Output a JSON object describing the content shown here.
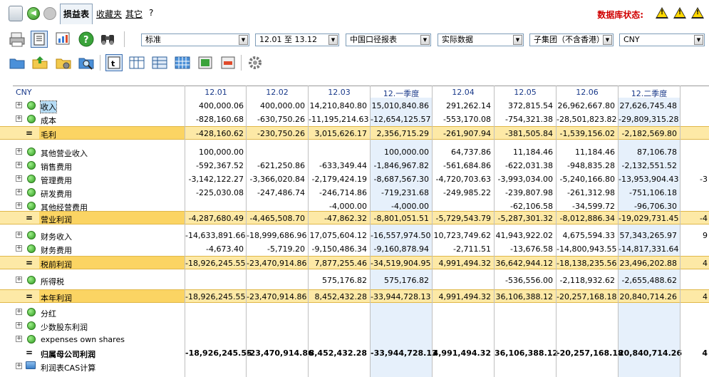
{
  "menu": {
    "tab_pl": "损益表",
    "favorites": "收藏夹",
    "other": "其它",
    "help": "?",
    "db_status": "数据库状态:",
    "warn_icons": [
      "!",
      "!",
      "!"
    ]
  },
  "filters": {
    "standard": "标准",
    "period": "12.01 至 13.12",
    "report": "中国口径报表",
    "data_type": "实际数据",
    "entity": "子集团（不含香港）",
    "currency": "CNY"
  },
  "grid": {
    "currency": "CNY",
    "columns": [
      "12.01",
      "12.02",
      "12.03",
      "12.一季度",
      "12.04",
      "12.05",
      "12.06",
      "12.二季度",
      ""
    ],
    "rows": [
      {
        "kind": "item",
        "label": "收入",
        "highlight": true,
        "values": [
          "400,000.06",
          "400,000.00",
          "14,210,840.80",
          "15,010,840.86",
          "291,262.14",
          "372,815.54",
          "26,962,667.80",
          "27,626,745.48",
          ""
        ]
      },
      {
        "kind": "item",
        "label": "成本",
        "values": [
          "-828,160.68",
          "-630,750.26",
          "-11,195,214.63",
          "-12,654,125.57",
          "-553,170.08",
          "-754,321.38",
          "-28,501,823.82",
          "-29,809,315.28",
          ""
        ]
      },
      {
        "kind": "sub",
        "label": "毛利",
        "values": [
          "-428,160.62",
          "-230,750.26",
          "3,015,626.17",
          "2,356,715.29",
          "-261,907.94",
          "-381,505.84",
          "-1,539,156.02",
          "-2,182,569.80",
          ""
        ]
      },
      {
        "kind": "item",
        "label": "其他营业收入",
        "values": [
          "100,000.00",
          "",
          "",
          "100,000.00",
          "64,737.86",
          "11,184.46",
          "11,184.46",
          "87,106.78",
          ""
        ]
      },
      {
        "kind": "item",
        "label": "销售费用",
        "values": [
          "-592,367.52",
          "-621,250.86",
          "-633,349.44",
          "-1,846,967.82",
          "-561,684.86",
          "-622,031.38",
          "-948,835.28",
          "-2,132,551.52",
          ""
        ]
      },
      {
        "kind": "item",
        "label": "管理费用",
        "values": [
          "-3,142,122.27",
          "-3,366,020.84",
          "-2,179,424.19",
          "-8,687,567.30",
          "-4,720,703.63",
          "-3,993,034.00",
          "-5,240,166.80",
          "-13,953,904.43",
          "-3"
        ]
      },
      {
        "kind": "item",
        "label": "研发费用",
        "values": [
          "-225,030.08",
          "-247,486.74",
          "-246,714.86",
          "-719,231.68",
          "-249,985.22",
          "-239,807.98",
          "-261,312.98",
          "-751,106.18",
          ""
        ]
      },
      {
        "kind": "item",
        "label": "其他经营费用",
        "values": [
          "",
          "",
          "-4,000.00",
          "-4,000.00",
          "",
          "-62,106.58",
          "-34,599.72",
          "-96,706.30",
          ""
        ]
      },
      {
        "kind": "sub",
        "label": "营业利润",
        "values": [
          "-4,287,680.49",
          "-4,465,508.70",
          "-47,862.32",
          "-8,801,051.51",
          "-5,729,543.79",
          "-5,287,301.32",
          "-8,012,886.34",
          "-19,029,731.45",
          "-4"
        ]
      },
      {
        "kind": "item",
        "label": "财务收入",
        "values": [
          "-14,633,891.66",
          "-18,999,686.96",
          "17,075,604.12",
          "-16,557,974.50",
          "10,723,749.62",
          "41,943,922.02",
          "4,675,594.33",
          "57,343,265.97",
          "9"
        ]
      },
      {
        "kind": "item",
        "label": "财务费用",
        "values": [
          "-4,673.40",
          "-5,719.20",
          "-9,150,486.34",
          "-9,160,878.94",
          "-2,711.51",
          "-13,676.58",
          "-14,800,943.55",
          "-14,817,331.64",
          ""
        ]
      },
      {
        "kind": "sub",
        "label": "税前利润",
        "values": [
          "-18,926,245.55",
          "-23,470,914.86",
          "7,877,255.46",
          "-34,519,904.95",
          "4,991,494.32",
          "36,642,944.12",
          "-18,138,235.56",
          "23,496,202.88",
          "4"
        ]
      },
      {
        "kind": "item",
        "label": "所得税",
        "values": [
          "",
          "",
          "575,176.82",
          "575,176.82",
          "",
          "-536,556.00",
          "-2,118,932.62",
          "-2,655,488.62",
          ""
        ]
      },
      {
        "kind": "sub",
        "label": "本年利润",
        "values": [
          "-18,926,245.55",
          "-23,470,914.86",
          "8,452,432.28",
          "-33,944,728.13",
          "4,991,494.32",
          "36,106,388.12",
          "-20,257,168.18",
          "20,840,714.26",
          "4"
        ]
      },
      {
        "kind": "item",
        "label": "分红",
        "values": [
          "",
          "",
          "",
          "",
          "",
          "",
          "",
          "",
          ""
        ]
      },
      {
        "kind": "item",
        "label": "少数股东利润",
        "values": [
          "",
          "",
          "",
          "",
          "",
          "",
          "",
          "",
          ""
        ]
      },
      {
        "kind": "item",
        "label": "expenses own shares",
        "values": [
          "",
          "",
          "",
          "",
          "",
          "",
          "",
          "",
          ""
        ]
      },
      {
        "kind": "total",
        "label": "归属母公司利润",
        "values": [
          "-18,926,245.55",
          "-23,470,914.86",
          "8,452,432.28",
          "-33,944,728.13",
          "4,991,494.32",
          "36,106,388.12",
          "-20,257,168.18",
          "20,840,714.26",
          "4"
        ]
      },
      {
        "kind": "folder",
        "label": "利润表CAS计算",
        "values": [
          "",
          "",
          "",
          "",
          "",
          "",
          "",
          "",
          ""
        ]
      }
    ]
  }
}
